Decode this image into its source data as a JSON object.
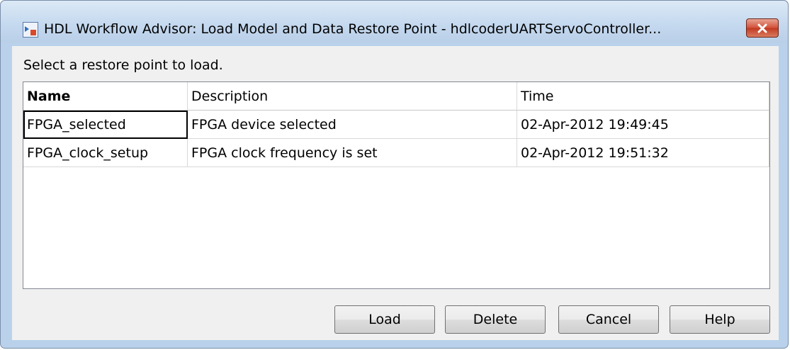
{
  "window": {
    "title": "HDL Workflow Advisor: Load Model and Data Restore Point - hdlcoderUARTServoController..."
  },
  "prompt": "Select a restore point to load.",
  "table": {
    "headers": [
      "Name",
      "Description",
      "Time"
    ],
    "rows": [
      [
        "FPGA_selected",
        "FPGA device selected",
        "02-Apr-2012 19:49:45"
      ],
      [
        "FPGA_clock_setup",
        "FPGA clock frequency is set",
        "02-Apr-2012 19:51:32"
      ]
    ]
  },
  "buttons": {
    "load": "Load",
    "delete": "Delete",
    "cancel": "Cancel",
    "help": "Help"
  }
}
